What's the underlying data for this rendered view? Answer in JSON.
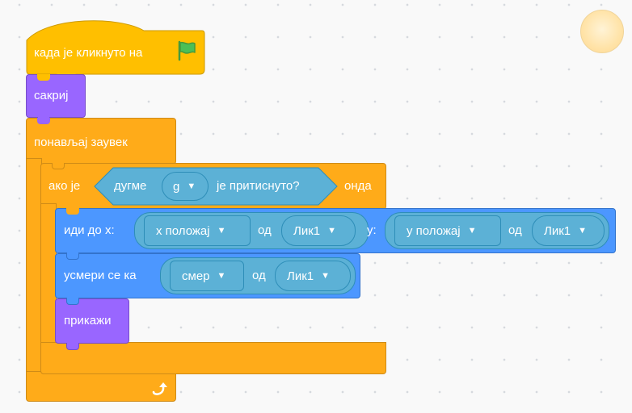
{
  "colors": {
    "events": "#FFBF00",
    "control": "#FFAB19",
    "looks": "#9966FF",
    "motion": "#4C97FF",
    "sensing": "#5CB1D6",
    "flag": "#4CBF56"
  },
  "blocks": {
    "when_flag": {
      "label": "када је кликнуто на",
      "icon": "green-flag-icon"
    },
    "hide": {
      "label": "сакриј"
    },
    "forever": {
      "label": "понављај заувек",
      "icon": "loop-arrow-icon"
    },
    "if_then": {
      "if_label": "ако је",
      "then_label": "онда"
    },
    "key_pressed": {
      "label_pre": "дугме",
      "key": "g",
      "label_post": "је притиснуто?"
    },
    "go_to_xy": {
      "label": "иди до x:",
      "x_attr": "x положај",
      "x_of": "од",
      "x_sprite": "Лик1",
      "y_label": "y:",
      "y_attr": "y положај",
      "y_of": "од",
      "y_sprite": "Лик1"
    },
    "point_towards": {
      "label": "усмери се ка",
      "attr": "смер",
      "of": "од",
      "sprite": "Лик1"
    },
    "show": {
      "label": "прикажи"
    }
  }
}
